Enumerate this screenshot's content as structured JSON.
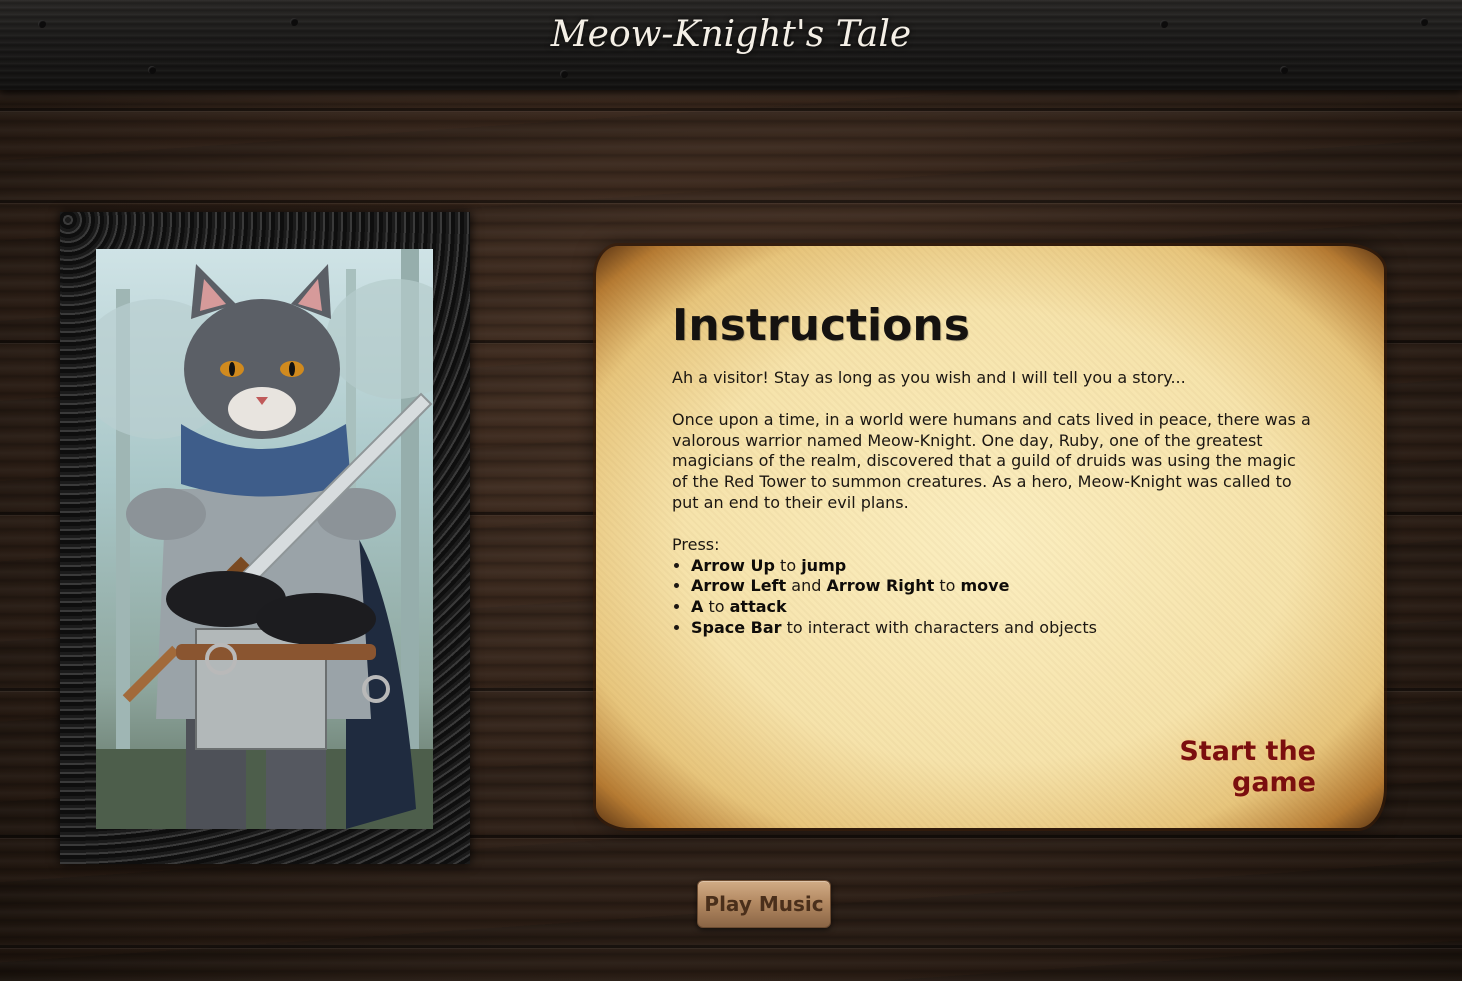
{
  "header": {
    "title": "Meow-Knight's Tale"
  },
  "portrait": {
    "subject": "cat-knight-portrait"
  },
  "instructions": {
    "heading": "Instructions",
    "intro": "Ah a visitor! Stay as long as you wish and I will tell you a story...",
    "story": "Once upon a time, in a world were humans and cats lived in peace, there was a valorous warrior named Meow-Knight. One day, Ruby, one of the greatest magicians of the realm, discovered that a guild of druids was using the magic of the Red Tower to summon creatures. As a hero, Meow-Knight was called to put an end to their evil plans.",
    "press_label": "Press:",
    "controls": [
      {
        "key": "Arrow Up",
        "sep": " to ",
        "action": "jump"
      },
      {
        "key": "Arrow Left",
        "mid": " and ",
        "key2": "Arrow Right",
        "sep": " to ",
        "action": "move"
      },
      {
        "key": "A",
        "sep": " to ",
        "action": "attack"
      },
      {
        "key": "Space Bar",
        "rest": " to interact with characters and objects"
      }
    ],
    "start_label": "Start the game"
  },
  "music": {
    "button_label": "Play Music"
  },
  "colors": {
    "start_link": "#7b0f0f",
    "parchment": "#f6e3ab",
    "wood": "#2f2118",
    "button": "#b48a63"
  }
}
